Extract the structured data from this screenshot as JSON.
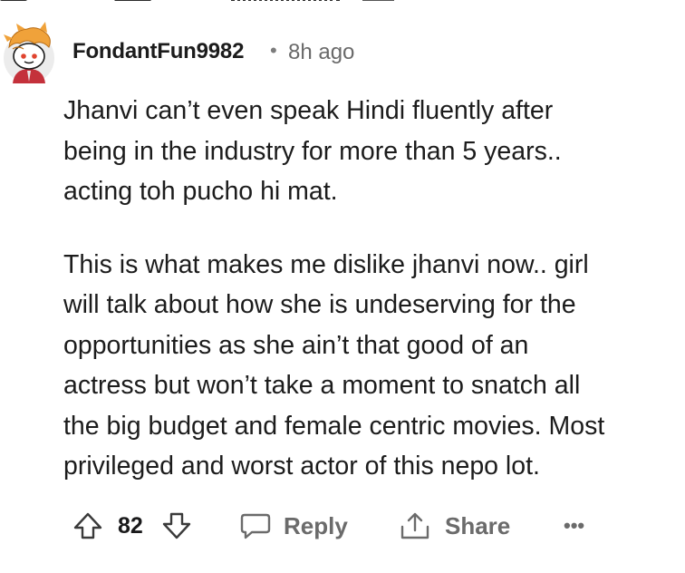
{
  "comment": {
    "username": "FondantFun9982",
    "separator": "•",
    "timestamp": "8h ago",
    "paragraphs": [
      "Jhanvi can’t even speak Hindi fluently after\nbeing in the industry for more than 5 years..\nacting toh pucho hi mat.",
      "This is what makes me dislike jhanvi now.. girl\nwill talk about how she is undeserving for the\nopportunities as she ain’t that good of an\nactress but won’t take a moment to snatch all\nthe big budget and female centric movies. Most\nprivileged and worst actor of this nepo lot."
    ],
    "avatar_icon": "snoo-avatar-icon"
  },
  "actions": {
    "upvote_icon": "upvote-arrow-icon",
    "score": "82",
    "downvote_icon": "downvote-arrow-icon",
    "reply_icon": "chat-bubble-icon",
    "reply_label": "Reply",
    "share_icon": "share-icon",
    "share_label": "Share",
    "more_label": "•••"
  },
  "colors": {
    "text": "#1c1c1c",
    "meta": "#6a6a6a",
    "avatar_hair": "#f0a23a",
    "avatar_skin": "#ffd9c2",
    "avatar_shirt": "#c4313b"
  }
}
